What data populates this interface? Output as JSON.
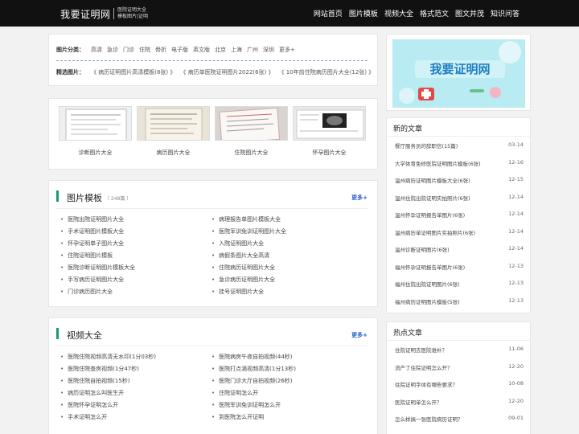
{
  "header": {
    "logo": "我要证明网",
    "sub1": "医院证明大全",
    "sub2": "模板图片|证明",
    "nav": [
      "网站首页",
      "图片模板",
      "视频大全",
      "格式范文",
      "图文并茂",
      "知识问答"
    ]
  },
  "categories": {
    "label1": "图片分类：",
    "tags": [
      "高清",
      "急诊",
      "门诊",
      "住院",
      "骨折",
      "电子版",
      "英文版",
      "北京",
      "上海",
      "广州",
      "深圳",
      "更多+"
    ],
    "label2": "精选图片：",
    "featured": [
      "《 病历证明图片高清模板(8张) 》",
      "《 病历单医院证明图片2022(6张) 》",
      "《 10年前住院病历图片大全(12张) 》"
    ]
  },
  "gallery": [
    {
      "caption": "诊断图片大全"
    },
    {
      "caption": "病历图片大全"
    },
    {
      "caption": "住院图片大全"
    },
    {
      "caption": "怀孕图片大全"
    }
  ],
  "templates": {
    "title": "图片模板",
    "count": "（ 248篇 ）",
    "more": "更多+",
    "left": [
      "医院出院证明图片大全",
      "手术证明图片模板大全",
      "怀孕证明单子图片大全",
      "住院证明图片模板",
      "医院诊断证明图片模板大全",
      "手写病历证明图片大全",
      "门诊病历图片大全"
    ],
    "right": [
      "病理报告单图片模板大全",
      "医院军训免训证明图片大全",
      "入院证明图片大全",
      "病假条图片大全高清",
      "住院病历证明图片大全",
      "急诊病历证明图片大全",
      "挂号证明图片大全"
    ]
  },
  "videos": {
    "title": "视频大全",
    "more": "更多+",
    "left": [
      "医院住院视频高清无水印(1分03秒)",
      "医院住院查房视频(1分47秒)",
      "医院住院自拍视频(15秒)",
      "病历证明怎么叫医生开",
      "医院怀孕证明怎么开",
      "手术证明怎么开"
    ],
    "right": [
      "医院病房午夜自拍视频(44秒)",
      "医院打点滴视频高清(1分13秒)",
      "医院门诊大厅自拍视频(26秒)",
      "住院证明怎么开",
      "医院军训免训证明怎么开",
      "到医院怎么开证明"
    ]
  },
  "sidebar": {
    "banner_alt": "我要证明网",
    "new_title": "新的文章",
    "new_articles": [
      {
        "t": "餐厅服务员的辞职信(15篇)",
        "d": "03-14"
      },
      {
        "t": "大学体育免修医院证明图片模板(6张)",
        "d": "12-16"
      },
      {
        "t": "温州病历证明图片模板大全(6张)",
        "d": "12-15"
      },
      {
        "t": "温州住院出院证明实拍照片(6张)",
        "d": "12-14"
      },
      {
        "t": "温州怀孕证明报告单图片(6张)",
        "d": "12-14"
      },
      {
        "t": "温州病历单证明图片实拍照片(6张)",
        "d": "12-14"
      },
      {
        "t": "温州诊断证明图片(6张)",
        "d": "12-14"
      },
      {
        "t": "福州怀孕证明报告单图片(6张)",
        "d": "12-13"
      },
      {
        "t": "福州住院出院证明图片(6张)",
        "d": "12-13"
      },
      {
        "t": "福州病历证明图片模板(5张)",
        "d": "12-13"
      }
    ],
    "hot_title": "热点文章",
    "hot_articles": [
      {
        "t": "住院证明去医院谁补？",
        "d": "11-06"
      },
      {
        "t": "流产了住院证明怎么开？",
        "d": "12-20"
      },
      {
        "t": "住院证明字体有哪些要求？",
        "d": "10-08"
      },
      {
        "t": "医院证明单怎么开？",
        "d": "12-20"
      },
      {
        "t": "怎么样搞一张医院病历证明？",
        "d": "09-01"
      }
    ]
  }
}
